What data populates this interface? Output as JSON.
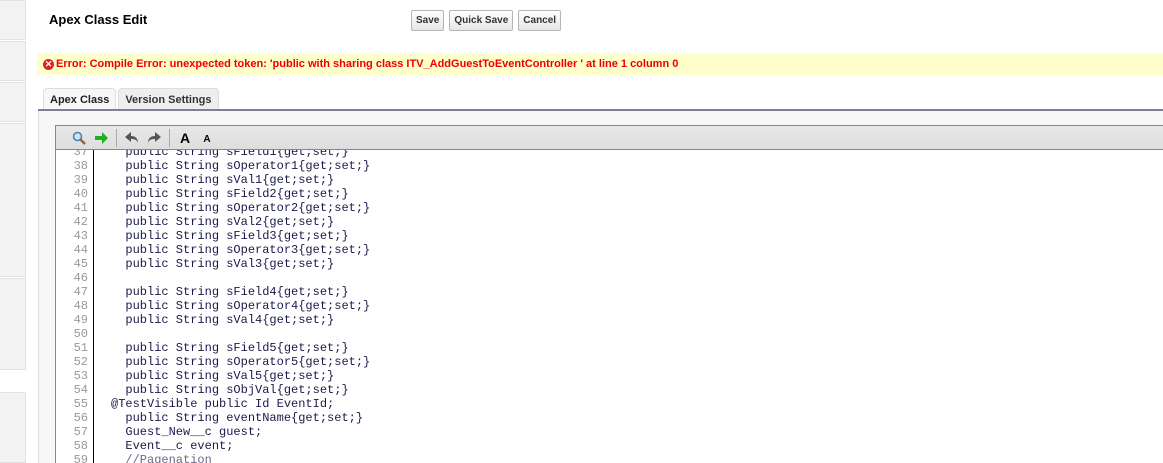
{
  "header": {
    "title": "Apex Class Edit",
    "buttons": {
      "save": "Save",
      "quick_save": "Quick Save",
      "cancel": "Cancel"
    }
  },
  "error": {
    "icon": "error-icon",
    "message": "Error: Compile Error: unexpected token: 'public with sharing class ITV_AddGuestToEventController ' at line 1 column 0",
    "color": "#ee0000",
    "background": "#ffffcc"
  },
  "tabs": [
    {
      "label": "Apex Class",
      "active": true
    },
    {
      "label": "Version Settings",
      "active": false
    }
  ],
  "toolbar": {
    "icons": [
      "search-icon",
      "go-to-line-icon",
      "undo-icon",
      "redo-icon",
      "font-larger-icon",
      "font-smaller-icon"
    ],
    "font_larger": "A",
    "font_smaller": "A"
  },
  "code": [
    {
      "n": "37",
      "t": "  public String sField1{get;set;}"
    },
    {
      "n": "38",
      "t": "  public String sOperator1{get;set;}"
    },
    {
      "n": "39",
      "t": "  public String sVal1{get;set;}"
    },
    {
      "n": "40",
      "t": "  public String sField2{get;set;}"
    },
    {
      "n": "41",
      "t": "  public String sOperator2{get;set;}"
    },
    {
      "n": "42",
      "t": "  public String sVal2{get;set;}"
    },
    {
      "n": "43",
      "t": "  public String sField3{get;set;}"
    },
    {
      "n": "44",
      "t": "  public String sOperator3{get;set;}"
    },
    {
      "n": "45",
      "t": "  public String sVal3{get;set;}"
    },
    {
      "n": "46",
      "t": ""
    },
    {
      "n": "47",
      "t": "  public String sField4{get;set;}"
    },
    {
      "n": "48",
      "t": "  public String sOperator4{get;set;}"
    },
    {
      "n": "49",
      "t": "  public String sVal4{get;set;}"
    },
    {
      "n": "50",
      "t": ""
    },
    {
      "n": "51",
      "t": "  public String sField5{get;set;}"
    },
    {
      "n": "52",
      "t": "  public String sOperator5{get;set;}"
    },
    {
      "n": "53",
      "t": "  public String sVal5{get;set;}"
    },
    {
      "n": "54",
      "t": "  public String sObjVal{get;set;}"
    },
    {
      "n": "55",
      "t": "@TestVisible public Id EventId;"
    },
    {
      "n": "56",
      "t": "  public String eventName{get;set;}"
    },
    {
      "n": "57",
      "t": "  Guest_New__c guest;"
    },
    {
      "n": "58",
      "t": "  Event__c event;"
    },
    {
      "n": "59",
      "t": "  //Pagenation"
    }
  ]
}
